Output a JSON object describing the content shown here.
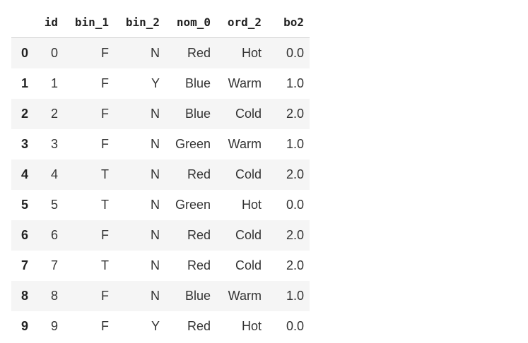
{
  "table": {
    "index_header": "",
    "columns": [
      "id",
      "bin_1",
      "bin_2",
      "nom_0",
      "ord_2",
      "bo2"
    ],
    "rows": [
      {
        "index": "0",
        "cells": [
          "0",
          "F",
          "N",
          "Red",
          "Hot",
          "0.0"
        ]
      },
      {
        "index": "1",
        "cells": [
          "1",
          "F",
          "Y",
          "Blue",
          "Warm",
          "1.0"
        ]
      },
      {
        "index": "2",
        "cells": [
          "2",
          "F",
          "N",
          "Blue",
          "Cold",
          "2.0"
        ]
      },
      {
        "index": "3",
        "cells": [
          "3",
          "F",
          "N",
          "Green",
          "Warm",
          "1.0"
        ]
      },
      {
        "index": "4",
        "cells": [
          "4",
          "T",
          "N",
          "Red",
          "Cold",
          "2.0"
        ]
      },
      {
        "index": "5",
        "cells": [
          "5",
          "T",
          "N",
          "Green",
          "Hot",
          "0.0"
        ]
      },
      {
        "index": "6",
        "cells": [
          "6",
          "F",
          "N",
          "Red",
          "Cold",
          "2.0"
        ]
      },
      {
        "index": "7",
        "cells": [
          "7",
          "T",
          "N",
          "Red",
          "Cold",
          "2.0"
        ]
      },
      {
        "index": "8",
        "cells": [
          "8",
          "F",
          "N",
          "Blue",
          "Warm",
          "1.0"
        ]
      },
      {
        "index": "9",
        "cells": [
          "9",
          "F",
          "Y",
          "Red",
          "Hot",
          "0.0"
        ]
      }
    ]
  },
  "colors": {
    "stripe": "#f5f5f5",
    "header_border": "#d0d0d0",
    "text": "#222222"
  }
}
